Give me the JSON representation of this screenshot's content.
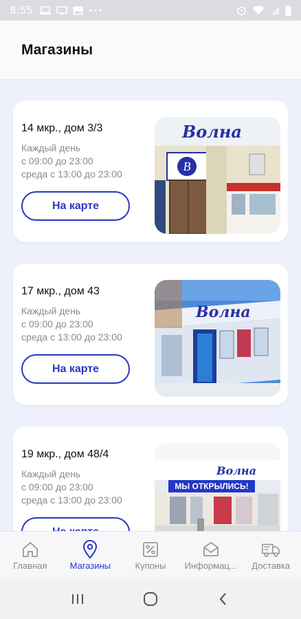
{
  "status_bar": {
    "time": "8:55"
  },
  "header": {
    "title": "Магазины"
  },
  "stores": [
    {
      "address": "14 мкр., дом 3/3",
      "hours_line1": "Каждый день",
      "hours_line2": "с 09:00 до 23:00",
      "hours_line3": "среда с 13:00 до 23:00",
      "map_button": "На карте",
      "sign_text": "Волна"
    },
    {
      "address": "17 мкр., дом 43",
      "hours_line1": "Каждый день",
      "hours_line2": "с 09:00 до 23:00",
      "hours_line3": "среда с 13:00 до 23:00",
      "map_button": "На карте",
      "sign_text": "Волна"
    },
    {
      "address": "19 мкр., дом 48/4",
      "hours_line1": "Каждый день",
      "hours_line2": "с 09:00 до 23:00",
      "hours_line3": "среда с 13:00 до 23:00",
      "map_button": "На карте",
      "sign_text": "Волна",
      "banner_text": "МЫ ОТКРЫЛИСЬ!"
    }
  ],
  "bottom_nav": [
    {
      "label": "Главная",
      "icon": "home-icon"
    },
    {
      "label": "Магазины",
      "icon": "location-pin-icon",
      "active": true
    },
    {
      "label": "Купоны",
      "icon": "coupon-percent-icon"
    },
    {
      "label": "Информац...",
      "icon": "envelope-icon"
    },
    {
      "label": "Доставка",
      "icon": "delivery-truck-icon"
    }
  ],
  "colors": {
    "accent": "#2b36c4",
    "background": "#eef0fb",
    "card": "#ffffff",
    "muted_text": "#8a8a8a"
  }
}
